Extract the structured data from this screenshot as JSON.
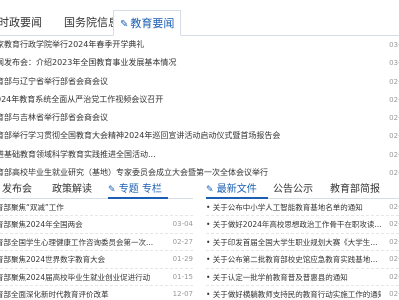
{
  "top_tabs": [
    "时政要闻",
    "国务院信息",
    "教育要闻"
  ],
  "news": [
    {
      "title": "家教育行政学院举行2024年春季开学典礼",
      "date": "03-0"
    },
    {
      "title": "闻发布会：介绍2023年全国教育事业发展基本情况",
      "date": "03-0"
    },
    {
      "title": "育部与辽宁省举行部省会商会议",
      "date": "02-2"
    },
    {
      "title": "024年教育系统全面从严治党工作视频会议召开",
      "date": "02-2"
    },
    {
      "title": "育部与吉林省举行部省会商会议",
      "date": "02-2"
    },
    {
      "title": "育部举行学习贯彻全国教育大会精神2024年巡回宣讲活动启动仪式暨首场报告会",
      "date": "02-0"
    },
    {
      "title": "进基础教育领域科学教育实践推进全国活动...",
      "date": "02-0"
    },
    {
      "title": "育部高校毕业生就业研究（基地）专家委员会成立大会暨第一次全体会议举行",
      "date": "02-0"
    }
  ],
  "left_section": {
    "tabs": [
      "发布会",
      "政策解读",
      "专题 专栏"
    ],
    "items": [
      {
        "title": "育部聚焦“双减”工作",
        "date": ""
      },
      {
        "title": "育部聚焦2024年全国两会",
        "date": "03-04"
      },
      {
        "title": "育部全国学生心理健康工作咨询委员会第一次...",
        "date": "02-27"
      },
      {
        "title": "育部聚焦2024世界数字教育大会",
        "date": "01-29"
      },
      {
        "title": "育部聚焦2024届高校毕业生就业创业促进行动",
        "date": "01-15"
      },
      {
        "title": "育部全面深化新时代教育评价改革",
        "date": "12-07"
      }
    ]
  },
  "right_section": {
    "tabs": [
      "最新文件",
      "公告公示",
      "教育部简报"
    ],
    "items": [
      {
        "title": "• 关于公布中小学人工智能教育基地名单的通知",
        "date": "02-1"
      },
      {
        "title": "• 关于做好2024年高校思想政治工作骨干在职攻读...",
        "date": "02-1"
      },
      {
        "title": "• 关于印发首届全国大学生职业规划大赛《大学生...",
        "date": "02-1"
      },
      {
        "title": "• 关于公布第二批教育部校史馆应急教育实践基地...",
        "date": "02-1"
      },
      {
        "title": "• 关于认定一批学前教育普及普惠县的通知",
        "date": "02-1"
      },
      {
        "title": "• 关于做好横躺教师支持民的教育行动实施工作的通知",
        "date": "02-1"
      }
    ]
  }
}
